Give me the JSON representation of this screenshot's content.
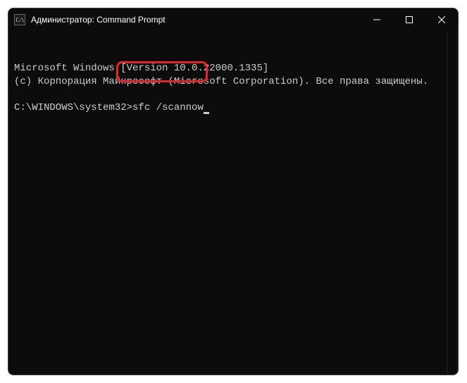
{
  "titlebar": {
    "title": "Администратор: Command Prompt",
    "icon_name": "cmd-icon"
  },
  "terminal": {
    "line1": "Microsoft Windows [Version 10.0.22000.1335]",
    "line2": "(c) Корпорация Майкрософт (Microsoft Corporation). Все права защищены.",
    "prompt": "C:\\WINDOWS\\system32>",
    "command": "sfc /scannow"
  },
  "annotation": {
    "highlight_target": "command-input"
  }
}
